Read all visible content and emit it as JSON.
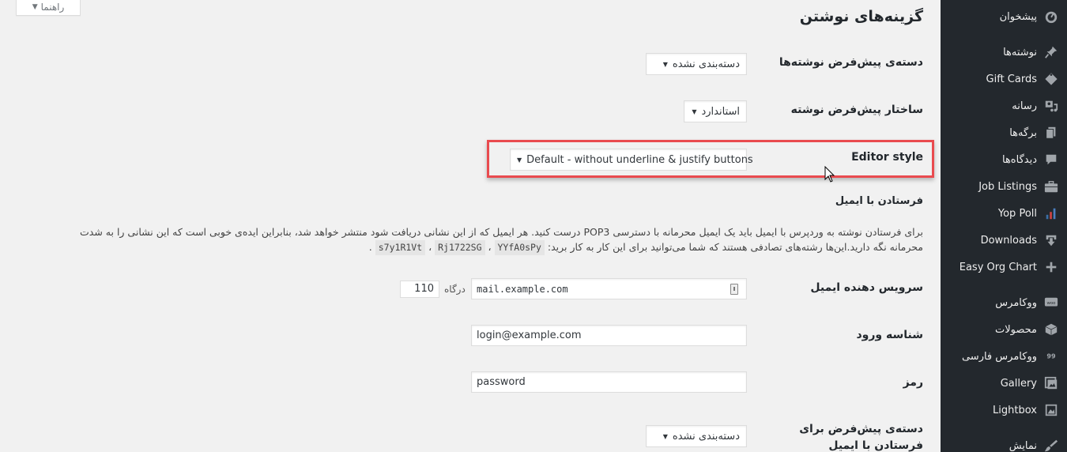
{
  "help_tab": {
    "label": "راهنما",
    "arrow": "▼"
  },
  "page": {
    "title": "گزینه‌های نوشتن"
  },
  "fields": {
    "default_category": {
      "label": "دسته‌ی پیش‌فرض نوشته‌ها",
      "value": "دسته‌بندی نشده"
    },
    "default_format": {
      "label": "ساختار پیش‌فرض نوشته",
      "value": "استاندارد"
    },
    "editor_style": {
      "label": "Editor style",
      "value": "Default - without underline & justify buttons"
    },
    "post_via_email": {
      "heading": "فرستادن با ایمیل",
      "description_line1": "برای فرستادن نوشته به وردپرس با ایمیل باید یک ایمیل محرمانه با دسترسی POP3 درست کنید. هر ایمیل که از این نشانی دریافت شود منتشر خواهد شد، بنابراین ایده‌ی خوبی است که این نشانی را به شدت",
      "description_line2": "محرمانه نگه دارید.این‌ها رشته‌های تصادفی هستند که شما می‌توانید برای این کار به کار برید:",
      "random_strings": [
        "YYfA0sPy",
        "Rj1722SG",
        "s7y1R1Vt"
      ],
      "separator": " ، ",
      "end_punct": " ."
    },
    "mail_server": {
      "label": "سرویس دهنده ایمیل",
      "value": "mail.example.com",
      "port_label": "درگاه",
      "port_value": "110"
    },
    "login_name": {
      "label": "شناسه ورود",
      "value": "login@example.com"
    },
    "password": {
      "label": "رمز",
      "value": "password"
    },
    "email_category": {
      "label_line1": "دسته‌ی پیش‌فرض برای",
      "label_line2": "فرستادن با ایمیل",
      "value": "دسته‌بندی نشده"
    }
  },
  "sidebar": {
    "items": [
      {
        "label": "پیشخوان",
        "icon": "dashboard-icon"
      },
      {
        "label": "نوشته‌ها",
        "icon": "pin-icon"
      },
      {
        "label": "Gift Cards",
        "icon": "gift-card-icon"
      },
      {
        "label": "رسانه",
        "icon": "media-icon"
      },
      {
        "label": "برگه‌ها",
        "icon": "pages-icon"
      },
      {
        "label": "دیدگاه‌ها",
        "icon": "comments-icon"
      },
      {
        "label": "Job Listings",
        "icon": "briefcase-icon"
      },
      {
        "label": "Yop Poll",
        "icon": "poll-chart-icon"
      },
      {
        "label": "Downloads",
        "icon": "download-icon"
      },
      {
        "label": "Easy Org Chart",
        "icon": "plus-icon"
      },
      {
        "label": "ووکامرس",
        "icon": "woo-icon"
      },
      {
        "label": "محصولات",
        "icon": "box-icon"
      },
      {
        "label": "ووکامرس فارسی",
        "icon": "quote-99-icon"
      },
      {
        "label": "Gallery",
        "icon": "gallery-icon"
      },
      {
        "label": "Lightbox",
        "icon": "image-icon"
      },
      {
        "label": "نمایش",
        "icon": "brush-icon"
      }
    ]
  }
}
